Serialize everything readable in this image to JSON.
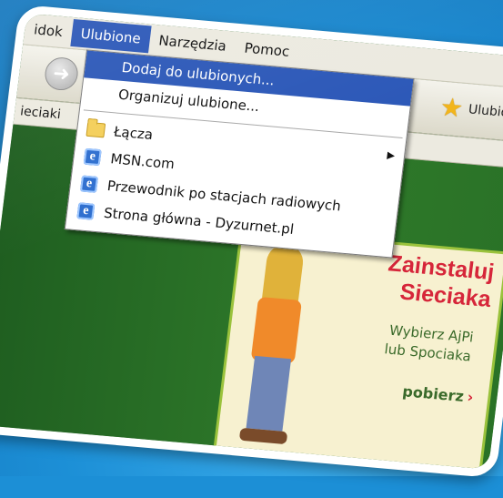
{
  "menubar": {
    "items": [
      "idok",
      "Ulubione",
      "Narzędzia",
      "Pomoc"
    ],
    "active_index": 1
  },
  "toolbar": {
    "favorites_label": "Ulubione",
    "back_icon": "back-arrow-icon",
    "favorites_icon": "star-icon"
  },
  "linksbar": {
    "label": "ieciaki"
  },
  "favorites_menu": {
    "add": "Dodaj do ulubionych...",
    "organize": "Organizuj ulubione...",
    "items": [
      {
        "label": "Łącza",
        "icon": "folder-icon",
        "submenu": true
      },
      {
        "label": "MSN.com",
        "icon": "ie-page-icon"
      },
      {
        "label": "Przewodnik po stacjach radiowych",
        "icon": "ie-page-icon"
      },
      {
        "label": "Strona główna - Dyzurnet.pl",
        "icon": "ie-page-icon"
      }
    ]
  },
  "promo": {
    "title_line1": "Zainstaluj",
    "title_line2": "Sieciaka",
    "sub_line1": "Wybierz AjPi",
    "sub_line2": "lub Spociaka",
    "cta": "pobierz",
    "cta_arrow": "›"
  },
  "colors": {
    "background": "#1c8fd6",
    "menu_highlight": "#2c58b8",
    "promo_red": "#d6263a",
    "content_green": "#2d6a2c"
  }
}
